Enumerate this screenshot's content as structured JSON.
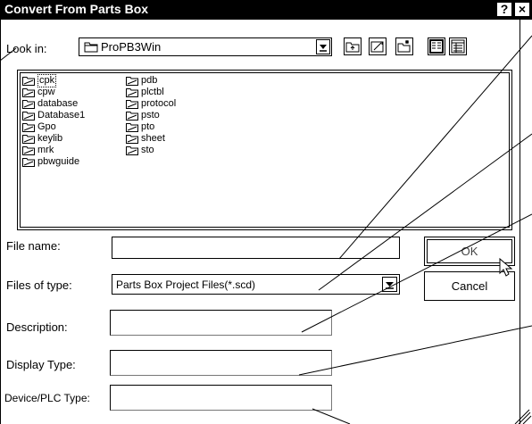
{
  "window": {
    "title": "Convert From Parts Box",
    "help_glyph": "?",
    "close_glyph": "×"
  },
  "lookin": {
    "label": "Look in:",
    "value": "ProPB3Win"
  },
  "files": {
    "column1": [
      "cpk",
      "cpw",
      "database",
      "Database1",
      "Gpo",
      "keylib",
      "mrk",
      "pbwguide"
    ],
    "column2": [
      "pdb",
      "plctbl",
      "protocol",
      "psto",
      "pto",
      "sheet",
      "sto"
    ],
    "selected": "cpk"
  },
  "form": {
    "file_name_label": "File name:",
    "file_name_value": "",
    "files_of_type_label": "Files of type:",
    "files_of_type_value": "Parts Box Project Files(*.scd)",
    "description_label": "Description:",
    "display_type_label": "Display Type:",
    "device_plc_label": "Device/PLC Type:"
  },
  "buttons": {
    "ok": "OK",
    "cancel": "Cancel"
  },
  "icons": [
    "folder-icon",
    "up-one-level-icon",
    "new-folder-icon",
    "desktop-icon",
    "list-view-icon",
    "details-view-icon",
    "dropdown-arrow-icon",
    "mouse-cursor-icon"
  ]
}
